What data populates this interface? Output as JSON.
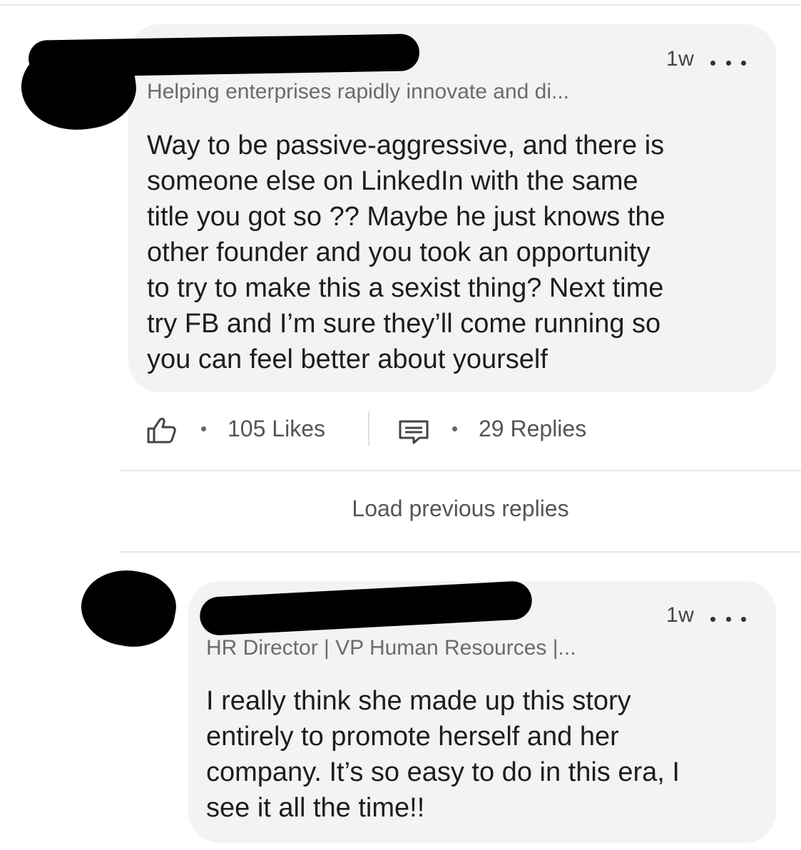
{
  "comment": {
    "timestamp": "1w",
    "headline": "Helping enterprises rapidly innovate and di...",
    "body_lines": [
      "Way to be passive-aggressive, and there is",
      "someone else on LinkedIn with the same",
      "title you got so ?? Maybe he just knows the",
      "other founder and you took an opportunity",
      "to try to make this a sexist thing? Next time",
      "try FB and I’m sure they’ll come running so",
      "you can feel better about yourself"
    ],
    "likes_label": "105 Likes",
    "replies_label": "29 Replies",
    "icons": {
      "like": "thumbs-up-icon",
      "reply": "comment-icon",
      "more": "more-options-icon"
    }
  },
  "load_previous_label": "Load previous replies",
  "reply": {
    "timestamp": "1w",
    "headline": "HR Director | VP Human Resources |...",
    "body_lines": [
      "I really think she made up this story",
      "entirely to promote herself and her",
      "company. It’s so easy to do in this era, I",
      "see it all the time!!"
    ]
  },
  "colors": {
    "bubble_bg": "#f1f3f5",
    "text_primary": "#1d1d1d",
    "text_secondary": "#6b6b6b",
    "divider": "#e6e6e6",
    "redaction": "#000000"
  }
}
